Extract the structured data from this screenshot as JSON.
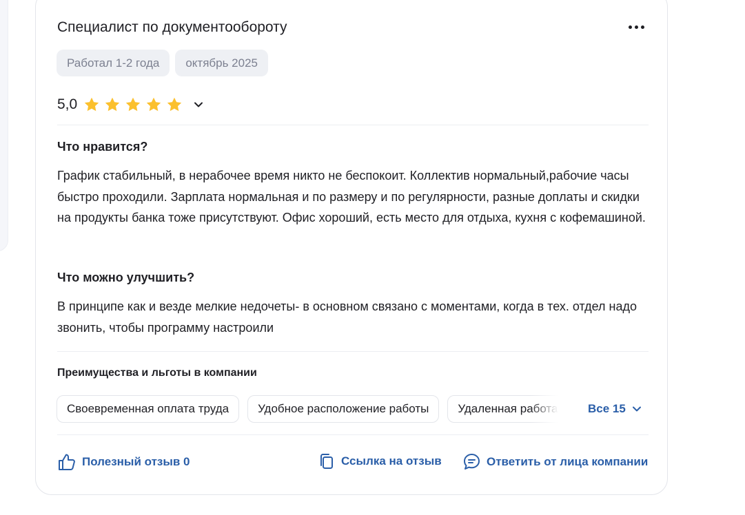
{
  "review": {
    "title": "Специалист по документообороту",
    "tags": [
      "Работал 1-2 года",
      "октябрь 2025"
    ],
    "rating": {
      "value_text": "5,0",
      "stars": 5,
      "max_stars": 5
    },
    "pros": {
      "heading": "Что нравится?",
      "text": "График стабильный, в нерабочее время никто не беспокоит. Коллектив нормальный,рабочие часы быстро проходили. Зарплата нормальная и по размеру и по регулярности, разные доплаты и скидки на продукты банка тоже присутствуют. Офис хороший, есть место для отдыха, кухня с кофемашиной."
    },
    "cons": {
      "heading": "Что можно улучшить?",
      "text": "В принципе как и везде мелкие недочеты- в основном связано с моментами, когда в тех. отдел надо звонить, чтобы программу настроили"
    },
    "benefits": {
      "heading": "Преимущества и льготы в компании",
      "chips": [
        "Своевременная оплата труда",
        "Удобное расположение работы",
        "Удаленная работа"
      ],
      "all_label": "Все 15"
    },
    "actions": {
      "useful": "Полезный отзыв 0",
      "link": "Ссылка на отзыв",
      "reply": "Ответить от лица компании"
    }
  },
  "icons": {
    "more": "more-horizontal-icon",
    "star": "star-icon",
    "chevron": "chevron-down-icon",
    "thumb": "thumbs-up-icon",
    "copy": "copy-link-icon",
    "reply": "chat-bubble-icon"
  },
  "colors": {
    "accent": "#2a5ea8",
    "star": "#fbc02d",
    "tag_bg": "#eef0f4",
    "tag_text": "#7c8090"
  }
}
